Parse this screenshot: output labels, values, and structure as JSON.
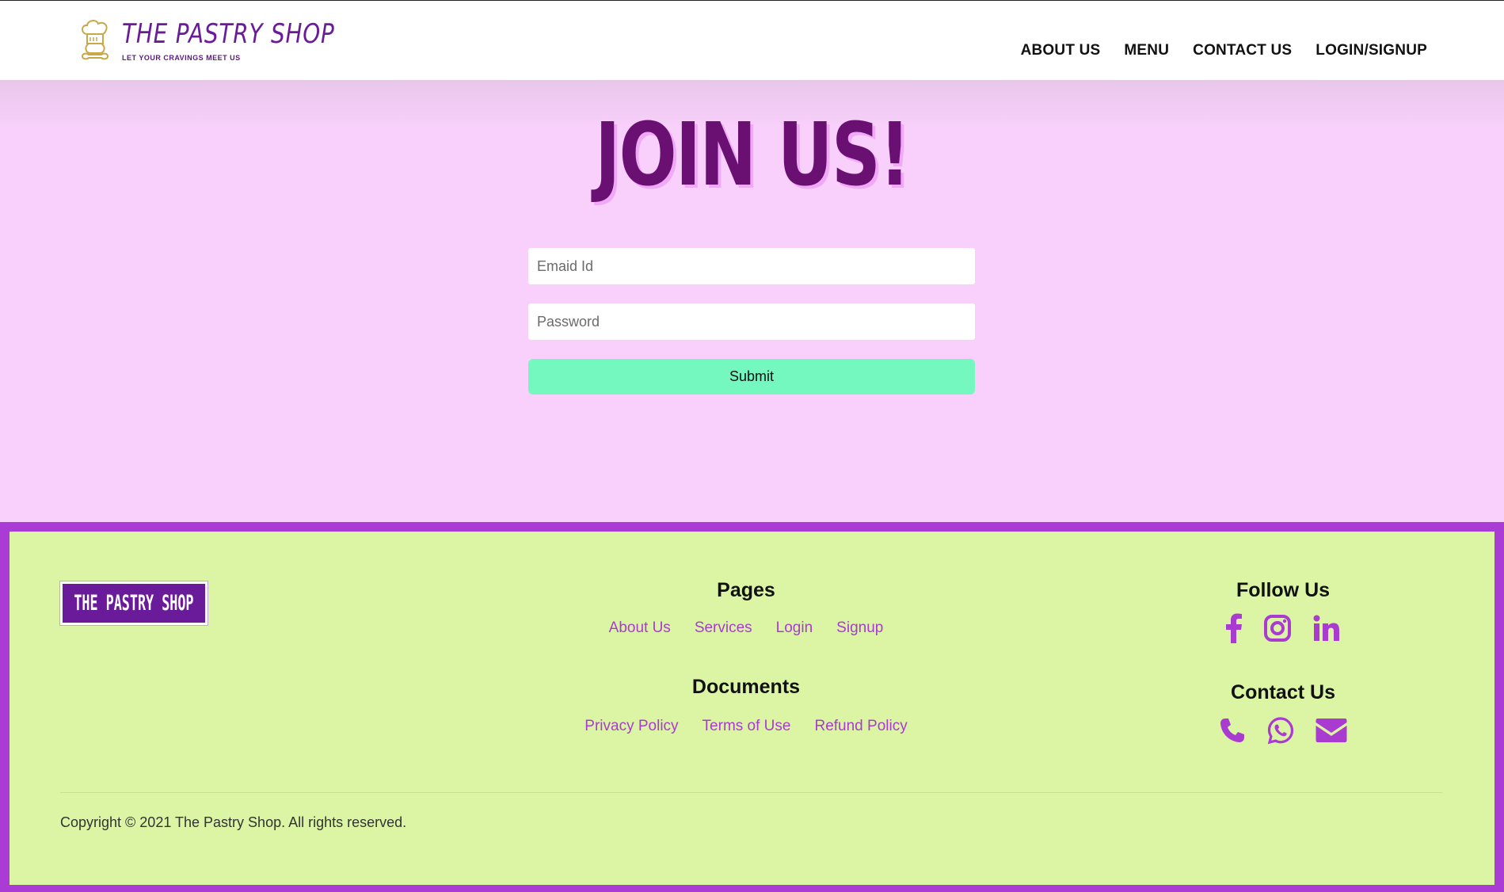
{
  "header": {
    "brand": {
      "title": "THE PASTRY SHOP",
      "tagline": "LET YOUR CRAVINGS MEET US",
      "icon": "chef-hat-icon"
    },
    "nav": [
      {
        "label": "ABOUT US"
      },
      {
        "label": "MENU"
      },
      {
        "label": "CONTACT US"
      },
      {
        "label": "LOGIN/SIGNUP"
      }
    ]
  },
  "main": {
    "title": "JOIN US!",
    "form": {
      "email_placeholder": "Emaid Id",
      "password_placeholder": "Password",
      "submit_label": "Submit"
    }
  },
  "footer": {
    "logo_text": "THE PASTRY SHOP",
    "pages": {
      "heading": "Pages",
      "links": [
        "About Us",
        "Services",
        "Login",
        "Signup"
      ]
    },
    "documents": {
      "heading": "Documents",
      "links": [
        "Privacy Policy",
        "Terms of Use",
        "Refund Policy"
      ]
    },
    "follow": {
      "heading": "Follow Us",
      "icons": [
        "facebook-icon",
        "instagram-icon",
        "linkedin-icon"
      ]
    },
    "contact": {
      "heading": "Contact Us",
      "icons": [
        "phone-icon",
        "whatsapp-icon",
        "envelope-icon"
      ]
    },
    "copyright": "Copyright © 2021 The Pastry Shop. All rights reserved."
  },
  "colors": {
    "page_bg": "#f8d0fb",
    "title": "#6a1073",
    "submit_bg": "#75f8bf",
    "footer_bg": "#dbf5a5",
    "footer_border": "#aa3bd4",
    "link": "#a93bd1"
  }
}
